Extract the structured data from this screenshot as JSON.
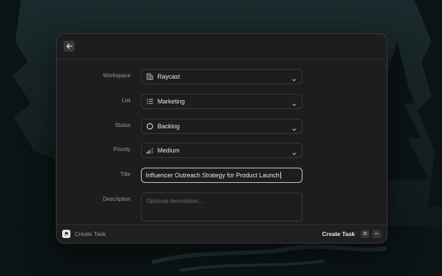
{
  "form": {
    "workspace": {
      "label": "Workspace",
      "value": "Raycast",
      "icon": "building-icon"
    },
    "list": {
      "label": "List",
      "value": "Marketing",
      "icon": "list-icon"
    },
    "status": {
      "label": "Status",
      "value": "Backlog",
      "icon": "circle-icon"
    },
    "priority": {
      "label": "Priority",
      "value": "Medium",
      "icon": "signal-bars-icon"
    },
    "title": {
      "label": "Title",
      "value": "Influencer Outreach Strategy for Product Launch"
    },
    "description": {
      "label": "Description",
      "placeholder": "Optional description..."
    }
  },
  "footer": {
    "title": "Create Task",
    "action_label": "Create Task",
    "shortcut_key1": "⌘",
    "shortcut_key2": "↵"
  }
}
